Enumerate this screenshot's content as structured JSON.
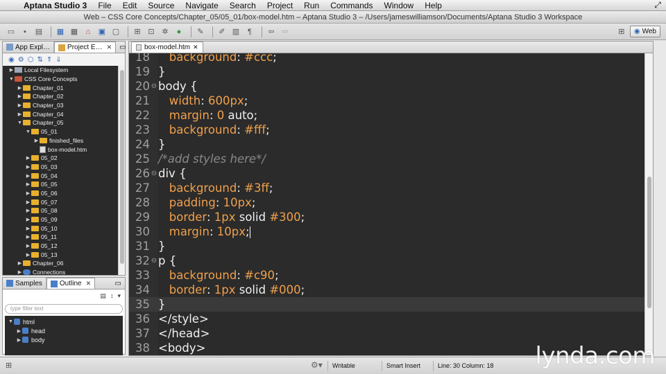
{
  "menubar": {
    "app_name": "Aptana Studio 3",
    "items": [
      "File",
      "Edit",
      "Source",
      "Navigate",
      "Search",
      "Project",
      "Run",
      "Commands",
      "Window",
      "Help"
    ]
  },
  "window": {
    "title": "Web – CSS Core Concepts/Chapter_05/05_01/box-model.htm – Aptana Studio 3 – /Users/jameswilliamson/Documents/Aptana Studio 3 Workspace"
  },
  "toolbar": {
    "perspective_label": "Web"
  },
  "project_panel": {
    "tabs": [
      {
        "label": "App Expl…",
        "active": false
      },
      {
        "label": "Project E…",
        "active": true
      }
    ],
    "tree": [
      {
        "label": "Local Filesystem",
        "level": 0,
        "expanded": false,
        "icon": "computer-icon"
      },
      {
        "label": "CSS Core Concepts",
        "level": 0,
        "expanded": true,
        "icon": "project-icon"
      },
      {
        "label": "Chapter_01",
        "level": 1,
        "expanded": false,
        "icon": "folder-icon"
      },
      {
        "label": "Chapter_02",
        "level": 1,
        "expanded": false,
        "icon": "folder-icon"
      },
      {
        "label": "Chapter_03",
        "level": 1,
        "expanded": false,
        "icon": "folder-icon"
      },
      {
        "label": "Chapter_04",
        "level": 1,
        "expanded": false,
        "icon": "folder-icon"
      },
      {
        "label": "Chapter_05",
        "level": 1,
        "expanded": true,
        "icon": "folder-icon"
      },
      {
        "label": "05_01",
        "level": 2,
        "expanded": true,
        "icon": "folder-icon"
      },
      {
        "label": "finished_files",
        "level": 3,
        "expanded": false,
        "icon": "folder-icon"
      },
      {
        "label": "box-model.htm",
        "level": 3,
        "expanded": null,
        "icon": "file-icon"
      },
      {
        "label": "05_02",
        "level": 2,
        "expanded": false,
        "icon": "folder-icon"
      },
      {
        "label": "05_03",
        "level": 2,
        "expanded": false,
        "icon": "folder-icon"
      },
      {
        "label": "05_04",
        "level": 2,
        "expanded": false,
        "icon": "folder-icon"
      },
      {
        "label": "05_05",
        "level": 2,
        "expanded": false,
        "icon": "folder-icon"
      },
      {
        "label": "05_06",
        "level": 2,
        "expanded": false,
        "icon": "folder-icon"
      },
      {
        "label": "05_07",
        "level": 2,
        "expanded": false,
        "icon": "folder-icon"
      },
      {
        "label": "05_08",
        "level": 2,
        "expanded": false,
        "icon": "folder-icon"
      },
      {
        "label": "05_09",
        "level": 2,
        "expanded": false,
        "icon": "folder-icon"
      },
      {
        "label": "05_10",
        "level": 2,
        "expanded": false,
        "icon": "folder-icon"
      },
      {
        "label": "05_11",
        "level": 2,
        "expanded": false,
        "icon": "folder-icon"
      },
      {
        "label": "05_12",
        "level": 2,
        "expanded": false,
        "icon": "folder-icon"
      },
      {
        "label": "05_13",
        "level": 2,
        "expanded": false,
        "icon": "folder-icon"
      },
      {
        "label": "Chapter_06",
        "level": 1,
        "expanded": false,
        "icon": "folder-icon"
      },
      {
        "label": "Connections",
        "level": 1,
        "expanded": false,
        "icon": "connections-icon"
      }
    ]
  },
  "outline_panel": {
    "tabs": [
      {
        "label": "Samples",
        "active": false
      },
      {
        "label": "Outline",
        "active": true
      }
    ],
    "filter_placeholder": "type filter text",
    "tree": [
      {
        "label": "html",
        "level": 0,
        "expanded": true
      },
      {
        "label": "head",
        "level": 1,
        "expanded": false
      },
      {
        "label": "body",
        "level": 1,
        "expanded": false
      }
    ]
  },
  "editor": {
    "tab_label": "box-model.htm",
    "lines": [
      {
        "num": "18",
        "fold": "",
        "parts": [
          [
            "plain",
            "   "
          ],
          [
            "prop",
            "background"
          ],
          [
            "plain",
            ": "
          ],
          [
            "val",
            "#ccc"
          ],
          [
            "plain",
            ";"
          ]
        ]
      },
      {
        "num": "19",
        "fold": "",
        "parts": [
          [
            "plain",
            "}"
          ]
        ]
      },
      {
        "num": "20",
        "fold": "⊖",
        "parts": [
          [
            "plain",
            "body {"
          ]
        ]
      },
      {
        "num": "21",
        "fold": "",
        "parts": [
          [
            "plain",
            "   "
          ],
          [
            "prop",
            "width"
          ],
          [
            "plain",
            ": "
          ],
          [
            "val",
            "600px"
          ],
          [
            "plain",
            ";"
          ]
        ]
      },
      {
        "num": "22",
        "fold": "",
        "parts": [
          [
            "plain",
            "   "
          ],
          [
            "prop",
            "margin"
          ],
          [
            "plain",
            ": "
          ],
          [
            "val",
            "0"
          ],
          [
            "plain",
            " auto;"
          ]
        ]
      },
      {
        "num": "23",
        "fold": "",
        "parts": [
          [
            "plain",
            "   "
          ],
          [
            "prop",
            "background"
          ],
          [
            "plain",
            ": "
          ],
          [
            "val",
            "#fff"
          ],
          [
            "plain",
            ";"
          ]
        ]
      },
      {
        "num": "24",
        "fold": "",
        "parts": [
          [
            "plain",
            "}"
          ]
        ]
      },
      {
        "num": "25",
        "fold": "",
        "parts": [
          [
            "comment",
            "/*add styles here*/"
          ]
        ]
      },
      {
        "num": "26",
        "fold": "⊖",
        "parts": [
          [
            "plain",
            "div {"
          ]
        ]
      },
      {
        "num": "27",
        "fold": "",
        "parts": [
          [
            "plain",
            "   "
          ],
          [
            "prop",
            "background"
          ],
          [
            "plain",
            ": "
          ],
          [
            "val",
            "#3ff"
          ],
          [
            "plain",
            ";"
          ]
        ]
      },
      {
        "num": "28",
        "fold": "",
        "parts": [
          [
            "plain",
            "   "
          ],
          [
            "prop",
            "padding"
          ],
          [
            "plain",
            ": "
          ],
          [
            "val",
            "10px"
          ],
          [
            "plain",
            ";"
          ]
        ]
      },
      {
        "num": "29",
        "fold": "",
        "parts": [
          [
            "plain",
            "   "
          ],
          [
            "prop",
            "border"
          ],
          [
            "plain",
            ": "
          ],
          [
            "val",
            "1px"
          ],
          [
            "plain",
            " solid "
          ],
          [
            "val",
            "#300"
          ],
          [
            "plain",
            ";"
          ]
        ]
      },
      {
        "num": "30",
        "fold": "",
        "parts": [
          [
            "plain",
            "   "
          ],
          [
            "prop",
            "margin"
          ],
          [
            "plain",
            ": "
          ],
          [
            "val",
            "10px"
          ],
          [
            "plain",
            ";"
          ]
        ],
        "cursor": true
      },
      {
        "num": "31",
        "fold": "",
        "parts": [
          [
            "plain",
            "}"
          ]
        ]
      },
      {
        "num": "32",
        "fold": "⊖",
        "parts": [
          [
            "plain",
            "p {"
          ]
        ]
      },
      {
        "num": "33",
        "fold": "",
        "parts": [
          [
            "plain",
            "   "
          ],
          [
            "prop",
            "background"
          ],
          [
            "plain",
            ": "
          ],
          [
            "val",
            "#c90"
          ],
          [
            "plain",
            ";"
          ]
        ]
      },
      {
        "num": "34",
        "fold": "",
        "parts": [
          [
            "plain",
            "   "
          ],
          [
            "prop",
            "border"
          ],
          [
            "plain",
            ": "
          ],
          [
            "val",
            "1px"
          ],
          [
            "plain",
            " solid "
          ],
          [
            "val",
            "#000"
          ],
          [
            "plain",
            ";"
          ]
        ]
      },
      {
        "num": "35",
        "fold": "",
        "parts": [
          [
            "plain",
            "}"
          ]
        ],
        "current": true
      },
      {
        "num": "36",
        "fold": "",
        "parts": [
          [
            "plain",
            "</style>"
          ]
        ]
      },
      {
        "num": "37",
        "fold": "",
        "parts": [
          [
            "plain",
            "</head>"
          ]
        ]
      },
      {
        "num": "38",
        "fold": "",
        "parts": [
          [
            "plain",
            "<body>"
          ]
        ]
      }
    ]
  },
  "statusbar": {
    "mode": "Writable",
    "insert_mode": "Smart Insert",
    "position": "Line: 30 Column: 18"
  },
  "watermark": "lynda.com"
}
